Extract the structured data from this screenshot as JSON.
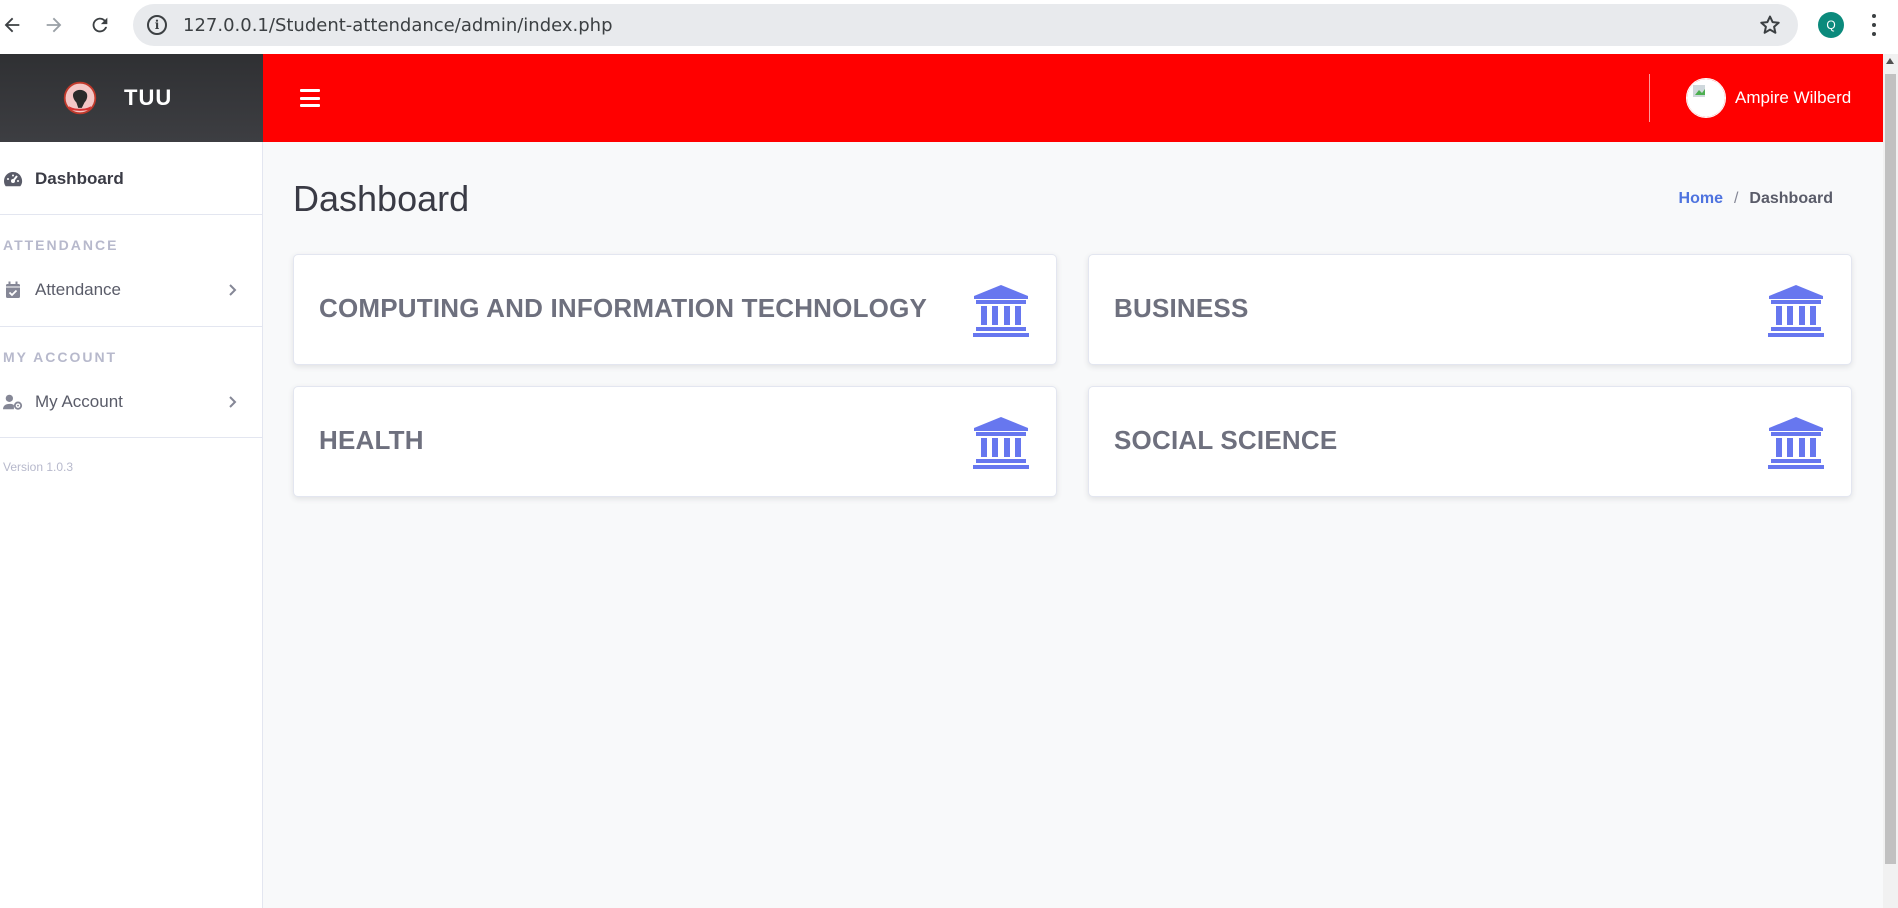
{
  "browser": {
    "url": "127.0.0.1/Student-attendance/admin/index.php",
    "profile_initial": "Q"
  },
  "brand": {
    "name": "TUU"
  },
  "topbar": {
    "user_name": "Ampire Wilberd",
    "accent_color": "#ff0000"
  },
  "sidebar": {
    "dashboard_label": "Dashboard",
    "attendance_heading": "ATTENDANCE",
    "attendance_label": "Attendance",
    "account_heading": "MY ACCOUNT",
    "account_label": "My Account",
    "version": "Version 1.0.3"
  },
  "main": {
    "page_title": "Dashboard",
    "breadcrumb": {
      "home": "Home",
      "separator": "/",
      "current": "Dashboard"
    },
    "cards": [
      {
        "title": "COMPUTING AND INFORMATION TECHNOLOGY",
        "icon": "university-icon"
      },
      {
        "title": "BUSINESS",
        "icon": "university-icon"
      },
      {
        "title": "HEALTH",
        "icon": "university-icon"
      },
      {
        "title": "SOCIAL SCIENCE",
        "icon": "university-icon"
      }
    ],
    "icon_color": "#6777ef"
  }
}
